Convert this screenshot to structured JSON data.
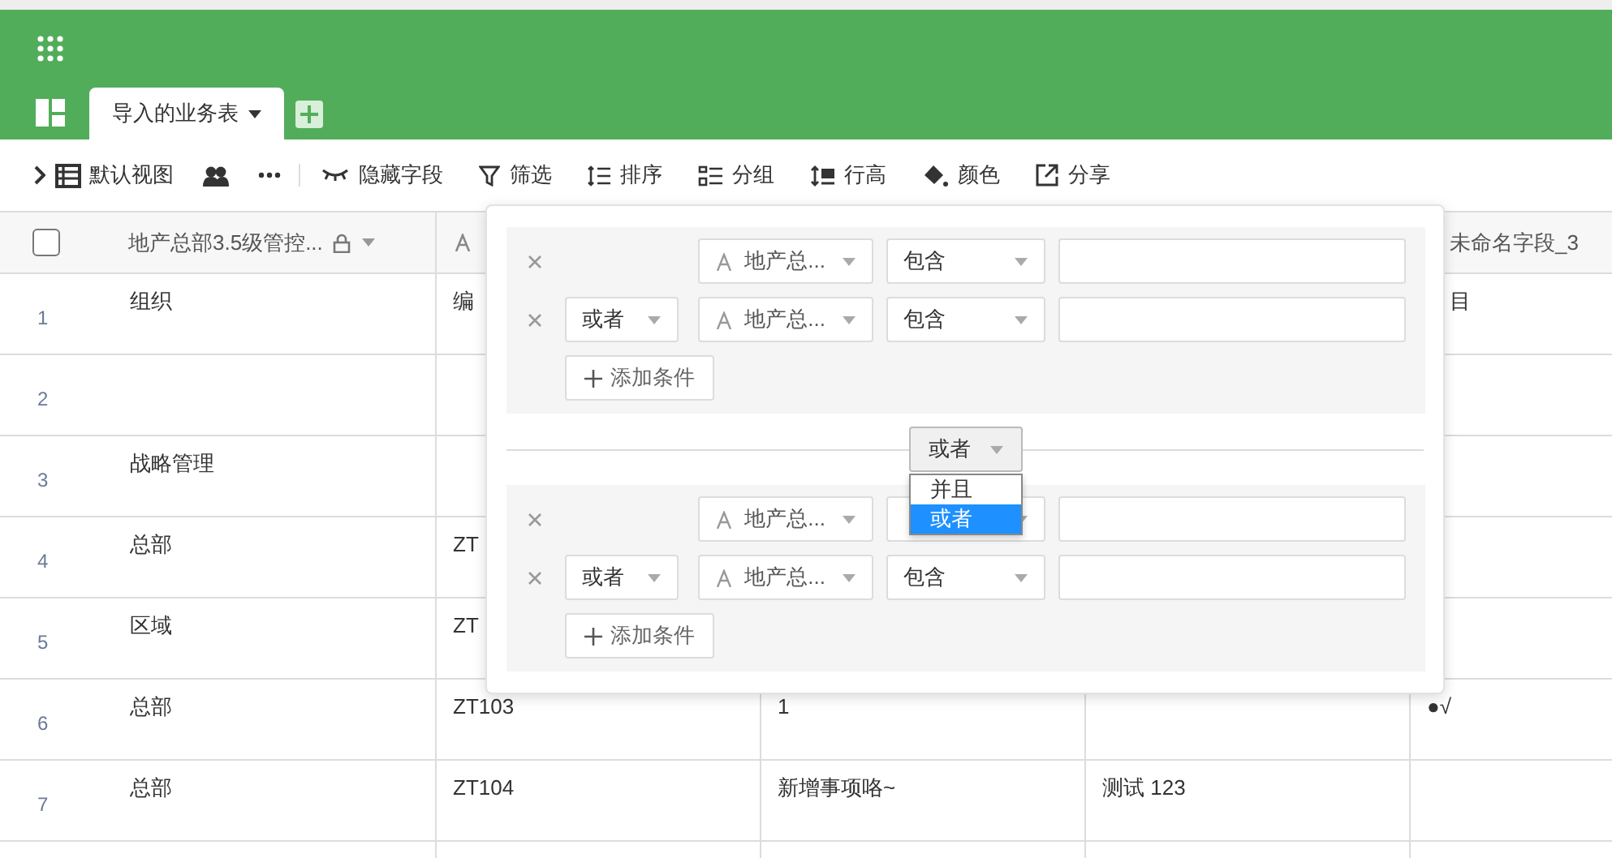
{
  "header": {
    "tabs": [
      {
        "label": "导入的业务表",
        "selected": true
      }
    ]
  },
  "toolbar": {
    "items": [
      {
        "kind": "view",
        "label": "默认视图"
      },
      {
        "kind": "people"
      },
      {
        "kind": "more"
      },
      {
        "kind": "divider"
      },
      {
        "kind": "hide",
        "label": "隐藏字段"
      },
      {
        "kind": "filter",
        "label": "筛选"
      },
      {
        "kind": "sort",
        "label": "排序"
      },
      {
        "kind": "group",
        "label": "分组"
      },
      {
        "kind": "height",
        "label": "行高"
      },
      {
        "kind": "color",
        "label": "颜色"
      },
      {
        "kind": "share",
        "label": "分享"
      }
    ]
  },
  "table": {
    "select_all": {
      "checked": false
    },
    "columns": [
      {
        "label": "地产总部3.5级管控...",
        "locked": true
      },
      {},
      {},
      {},
      {
        "label": "未命名字段_3"
      }
    ],
    "rows": [
      {
        "number": "1",
        "cells": [
          "组织",
          "编",
          null,
          null,
          "目"
        ]
      },
      {
        "number": "2",
        "cells": [
          null,
          null,
          null,
          null,
          null
        ]
      },
      {
        "number": "3",
        "cells": [
          "战略管理",
          null,
          null,
          null,
          null
        ]
      },
      {
        "number": "4",
        "cells": [
          "总部",
          "ZT",
          null,
          null,
          null
        ]
      },
      {
        "number": "5",
        "cells": [
          "区域",
          "ZT",
          null,
          null,
          null
        ]
      },
      {
        "number": "6",
        "cells": [
          "总部",
          "ZT103",
          "1",
          null,
          "●√"
        ]
      },
      {
        "number": "7",
        "cells": [
          "总部",
          "ZT104",
          "新增事项咯~",
          "测试 123",
          null
        ]
      }
    ]
  },
  "filter_panel": {
    "groups": [
      {
        "conditions": [
          {
            "field": "地产总...",
            "operator": "包含"
          },
          {
            "conjunction": "或者",
            "field": "地产总...",
            "operator": "包含"
          }
        ],
        "add_label": "添加条件"
      },
      {
        "conditions": [
          {
            "field": "地产总..."
          },
          {
            "conjunction": "或者",
            "field": "地产总...",
            "operator": "包含"
          }
        ],
        "add_label": "添加条件"
      }
    ],
    "group_conjunction": {
      "value": "或者",
      "expanded": true,
      "options": [
        {
          "label": "并且",
          "selected": false
        },
        {
          "label": "或者",
          "selected": true
        }
      ]
    }
  }
}
